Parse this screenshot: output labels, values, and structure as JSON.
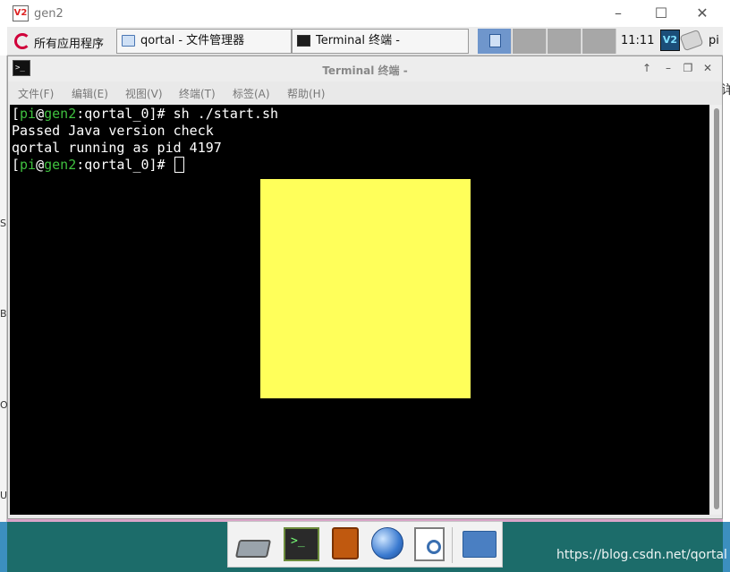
{
  "outer_window": {
    "title": "gen2",
    "app_icon": "vnc-viewer-icon",
    "controls": [
      "minimize",
      "maximize",
      "close"
    ]
  },
  "panel": {
    "menu_label": "所有应用程序",
    "tasks": [
      {
        "label": "qortal - 文件管理器",
        "icon": "folder-icon"
      },
      {
        "label": "Terminal 终端 -",
        "icon": "terminal-icon"
      }
    ],
    "desktops": 4,
    "active_desktop": 1,
    "clock": "11:11",
    "user": "pi"
  },
  "terminal": {
    "title": "Terminal 终端 -",
    "menu": [
      "文件(F)",
      "编辑(E)",
      "视图(V)",
      "终端(T)",
      "标签(A)",
      "帮助(H)"
    ],
    "prompt": {
      "open": "[",
      "user": "pi",
      "at": "@",
      "host": "gen2",
      "path": ":qortal_0",
      "close": "]# "
    },
    "command": "sh ./start.sh",
    "output": [
      "Passed Java version check",
      "qortal running as pid 4197"
    ],
    "colors": {
      "background": "#000000",
      "text": "#ffffff",
      "prompt": "#3fc13f"
    }
  },
  "overlay": {
    "color": "#ffff5a"
  },
  "dock": {
    "items": [
      "drive-icon",
      "terminal-icon",
      "book-icon",
      "browser-globe-icon",
      "document-viewer-icon",
      "folder-icon"
    ]
  },
  "edge_fragments": {
    "left": [
      "S",
      "B",
      "O",
      "U"
    ],
    "right": "详"
  },
  "watermark": "https://blog.csdn.net/qortal"
}
